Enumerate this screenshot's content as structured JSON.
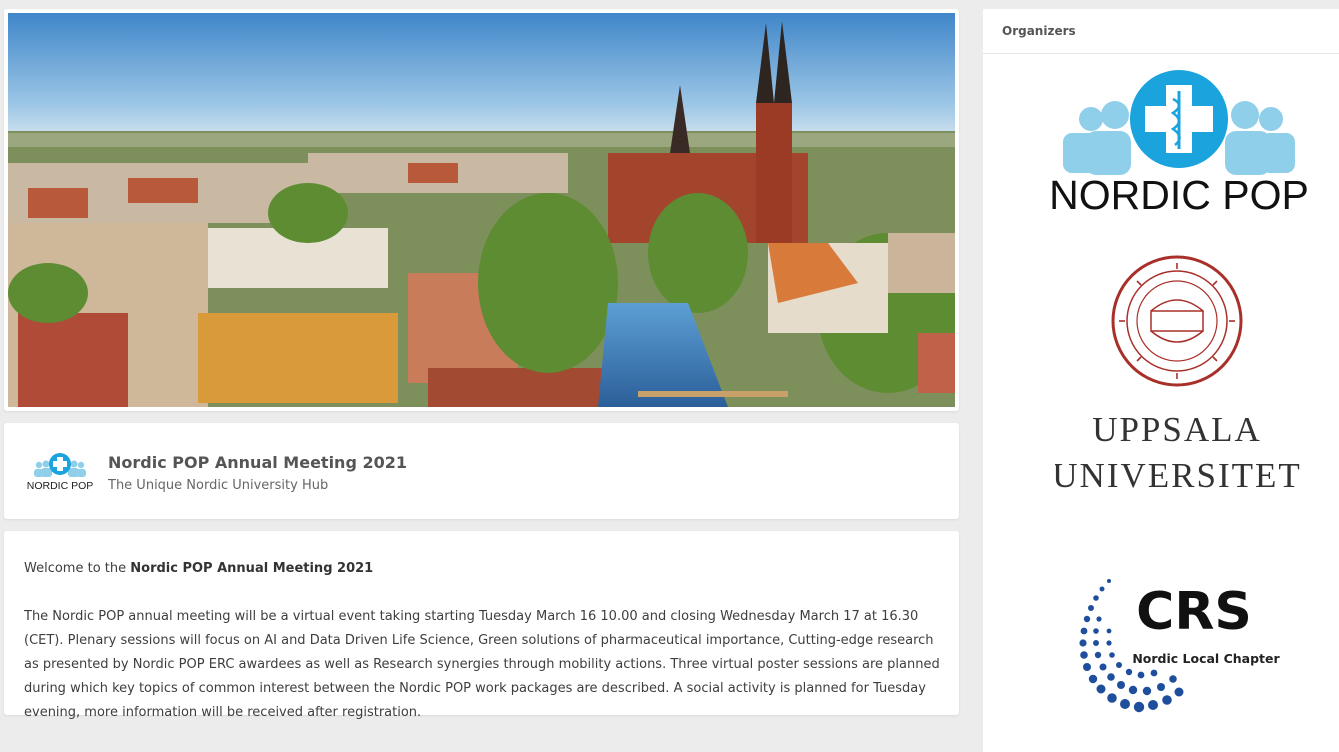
{
  "event": {
    "title": "Nordic POP Annual Meeting 2021",
    "subtitle": "The Unique Nordic University Hub",
    "logo_text": "NORDIC POP"
  },
  "description": {
    "welcome_prefix": "Welcome to the",
    "welcome_bold": "Nordic POP Annual Meeting 2021",
    "body": "The Nordic POP annual meeting will be a virtual event taking starting Tuesday March 16 10.00 and closing Wednesday March 17 at 16.30 (CET). Plenary sessions will focus on AI and Data Driven Life Science, Green solutions of pharmaceutical importance, Cutting-edge research as presented by Nordic POP ERC awardees as well as Research synergies through mobility actions. Three virtual poster sessions are planned during which key topics of common interest between the Nordic POP work packages are described. A social activity is planned for Tuesday evening, more information will be received after registration."
  },
  "sidebar": {
    "header": "Organizers",
    "organizers": [
      {
        "name": "NORDIC POP",
        "icon": "nordic-pop-logo"
      },
      {
        "name_line1": "UPPSALA",
        "name_line2": "UNIVERSITET",
        "icon": "uppsala-seal"
      },
      {
        "name": "CRS",
        "subtitle": "Nordic Local Chapter",
        "icon": "crs-logo"
      }
    ]
  },
  "colors": {
    "brand_blue": "#1aa3dc",
    "light_blue": "#8fcfea",
    "uppsala_red": "#a8302a",
    "background": "#ececec"
  }
}
